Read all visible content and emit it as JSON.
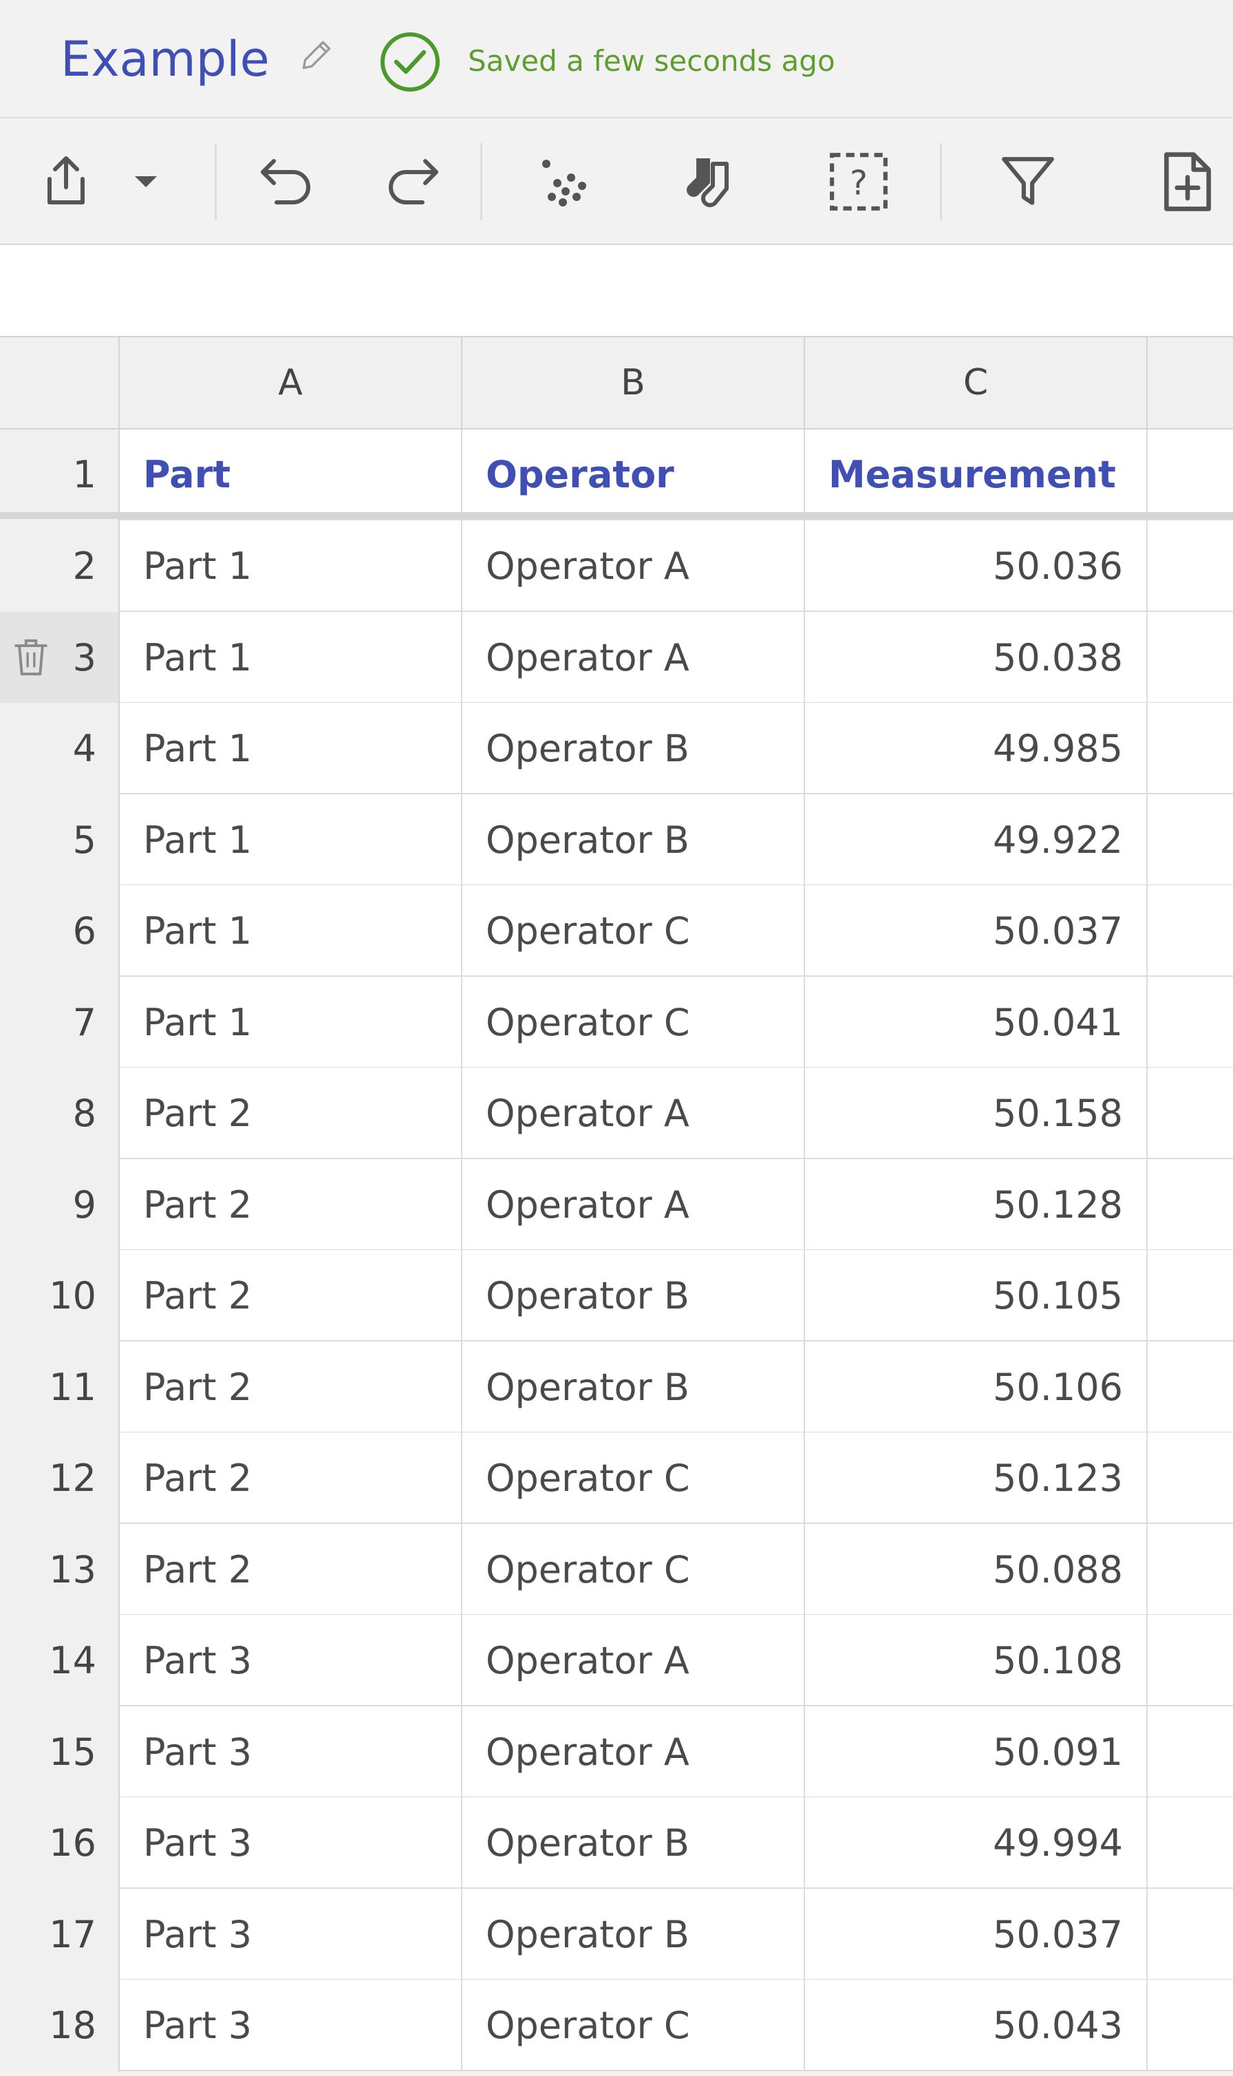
{
  "header": {
    "title": "Example",
    "saved_status": "Saved a few seconds ago"
  },
  "toolbar": {
    "buttons": [
      {
        "name": "export-icon"
      },
      {
        "name": "dropdown-caret-icon"
      },
      {
        "name": "undo-icon"
      },
      {
        "name": "redo-icon"
      },
      {
        "name": "scatter-plot-icon"
      },
      {
        "name": "socks-icon"
      },
      {
        "name": "help-box-icon"
      },
      {
        "name": "filter-icon"
      },
      {
        "name": "new-file-icon"
      }
    ]
  },
  "formula_bar": {
    "value": ""
  },
  "sheet": {
    "columns": [
      "A",
      "B",
      "C"
    ],
    "header_row": {
      "row": "1",
      "cells": [
        "Part",
        "Operator",
        "Measurement"
      ]
    },
    "rows": [
      {
        "row": "2",
        "part": "Part 1",
        "operator": "Operator A",
        "measurement": "50.036"
      },
      {
        "row": "3",
        "part": "Part 1",
        "operator": "Operator A",
        "measurement": "50.038"
      },
      {
        "row": "4",
        "part": "Part 1",
        "operator": "Operator B",
        "measurement": "49.985"
      },
      {
        "row": "5",
        "part": "Part 1",
        "operator": "Operator B",
        "measurement": "49.922"
      },
      {
        "row": "6",
        "part": "Part 1",
        "operator": "Operator C",
        "measurement": "50.037"
      },
      {
        "row": "7",
        "part": "Part 1",
        "operator": "Operator C",
        "measurement": "50.041"
      },
      {
        "row": "8",
        "part": "Part 2",
        "operator": "Operator A",
        "measurement": "50.158"
      },
      {
        "row": "9",
        "part": "Part 2",
        "operator": "Operator A",
        "measurement": "50.128"
      },
      {
        "row": "10",
        "part": "Part 2",
        "operator": "Operator B",
        "measurement": "50.105"
      },
      {
        "row": "11",
        "part": "Part 2",
        "operator": "Operator B",
        "measurement": "50.106"
      },
      {
        "row": "12",
        "part": "Part 2",
        "operator": "Operator C",
        "measurement": "50.123"
      },
      {
        "row": "13",
        "part": "Part 2",
        "operator": "Operator C",
        "measurement": "50.088"
      },
      {
        "row": "14",
        "part": "Part 3",
        "operator": "Operator A",
        "measurement": "50.108"
      },
      {
        "row": "15",
        "part": "Part 3",
        "operator": "Operator A",
        "measurement": "50.091"
      },
      {
        "row": "16",
        "part": "Part 3",
        "operator": "Operator B",
        "measurement": "49.994"
      },
      {
        "row": "17",
        "part": "Part 3",
        "operator": "Operator B",
        "measurement": "50.037"
      },
      {
        "row": "18",
        "part": "Part 3",
        "operator": "Operator C",
        "measurement": "50.043"
      }
    ],
    "hovered_row_action": "trash-icon"
  },
  "colors": {
    "title": "#3f4fb3",
    "saved": "#5e9e2f",
    "header_text": "#3f4fb3"
  }
}
